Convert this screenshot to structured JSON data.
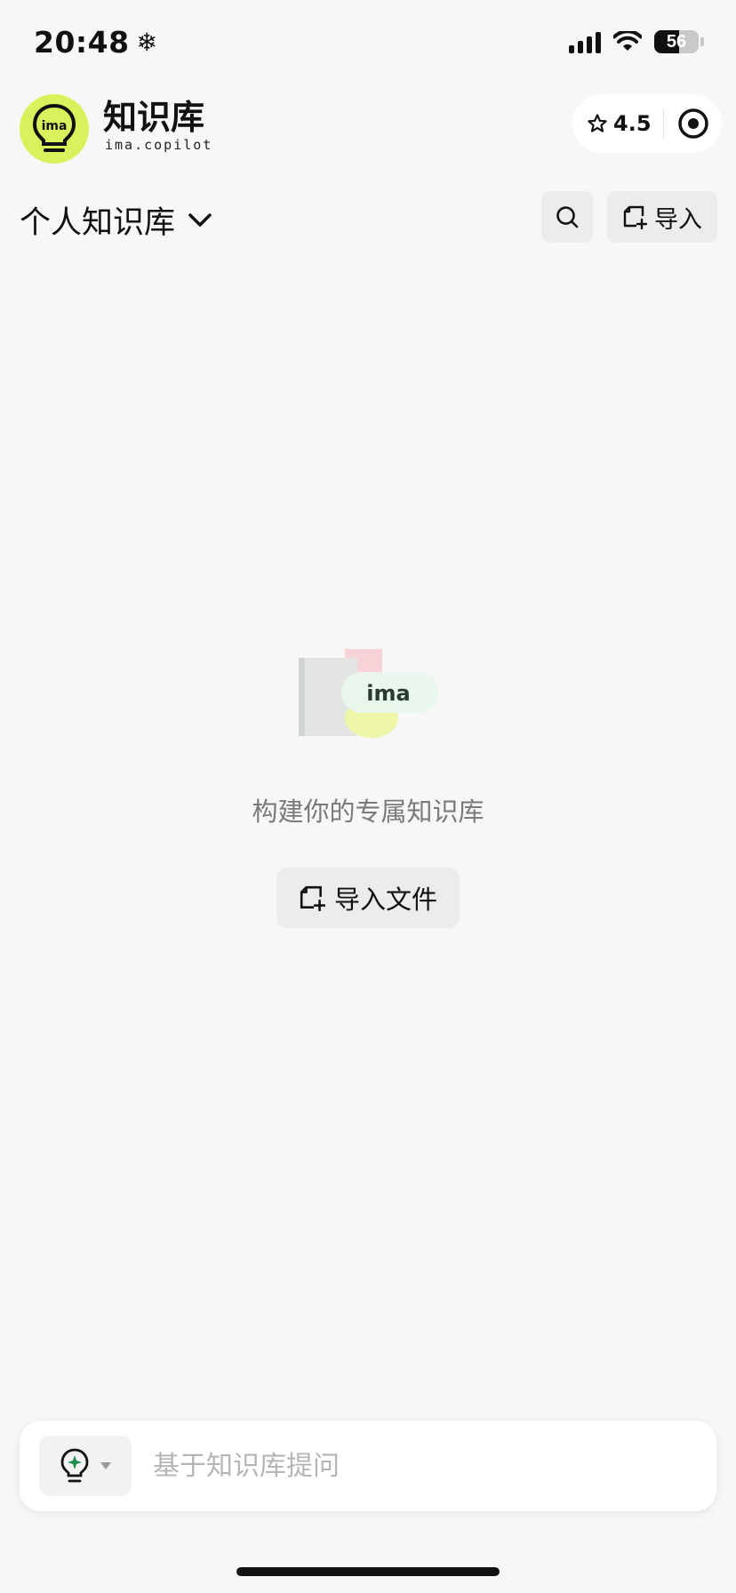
{
  "status_bar": {
    "time": "20:48",
    "snow_glyph": "❄",
    "battery_level": "56",
    "battery_percent": 56
  },
  "header": {
    "title": "知识库",
    "subtitle": "ima.copilot",
    "logo_text": "ima",
    "rating": "4.5",
    "star_icon": "star-icon",
    "target_icon": "target-icon"
  },
  "section": {
    "kb_name": "个人知识库",
    "import_label": "导入"
  },
  "empty_state": {
    "illustration_text": "ima",
    "message": "构建你的专属知识库",
    "import_file_label": "导入文件"
  },
  "ask_bar": {
    "placeholder": "基于知识库提问"
  },
  "colors": {
    "accent": "#d9f25c",
    "background": "#f7f7f7",
    "button_bg": "#ececec",
    "mode_icon_green": "#1e8f4e"
  }
}
